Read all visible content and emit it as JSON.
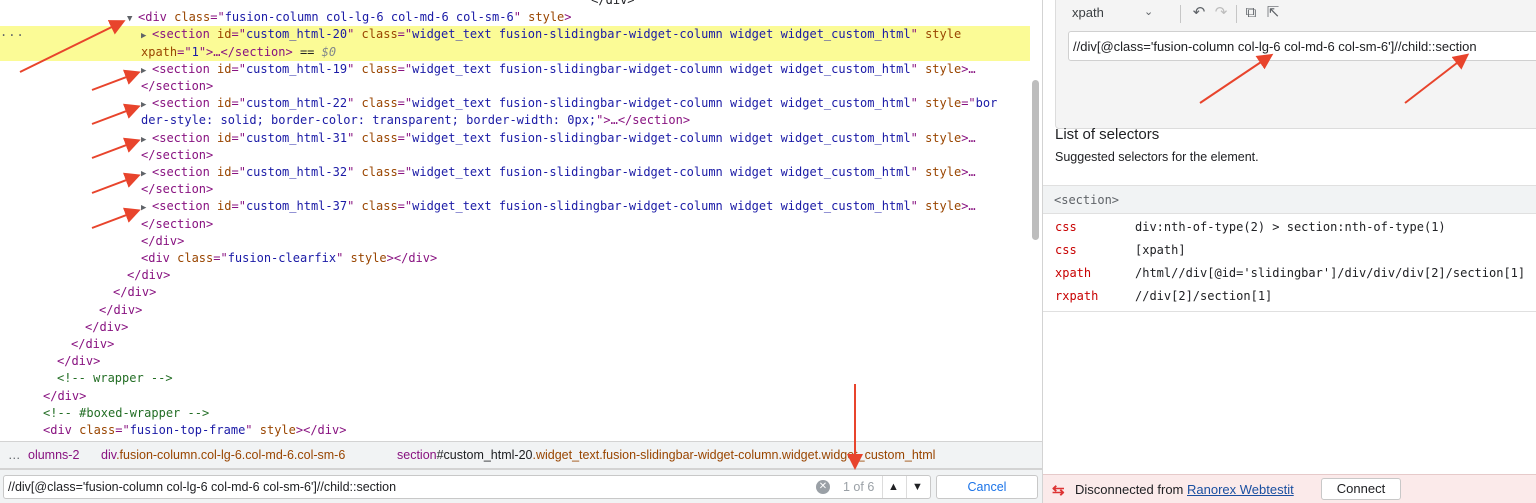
{
  "dom_tree": {
    "lines": [
      {
        "gutter": "",
        "indent": 71,
        "tokens": [
          {
            "c": "pl",
            "t": "                                                                        </div>"
          }
        ]
      },
      {
        "gutter": "",
        "indent": 127,
        "tokens": [
          {
            "c": "tri",
            "t": "▼"
          },
          {
            "c": "t",
            "t": "<div "
          },
          {
            "c": "an",
            "t": "class"
          },
          {
            "c": "t",
            "t": "=\""
          },
          {
            "c": "av",
            "t": "fusion-column col-lg-6 col-md-6 col-sm-6"
          },
          {
            "c": "t",
            "t": "\" "
          },
          {
            "c": "an",
            "t": "style"
          },
          {
            "c": "t",
            "t": ">"
          }
        ]
      },
      {
        "gutter": "...",
        "indent": 141,
        "sel": true,
        "tokens": [
          {
            "c": "tri",
            "t": "▶"
          },
          {
            "c": "t",
            "t": "<section "
          },
          {
            "c": "an",
            "t": "id"
          },
          {
            "c": "t",
            "t": "=\""
          },
          {
            "c": "av",
            "t": "custom_html-20"
          },
          {
            "c": "t",
            "t": "\" "
          },
          {
            "c": "an",
            "t": "class"
          },
          {
            "c": "t",
            "t": "=\""
          },
          {
            "c": "av",
            "t": "widget_text fusion-slidingbar-widget-column widget widget_custom_html"
          },
          {
            "c": "t",
            "t": "\" "
          },
          {
            "c": "an",
            "t": "style"
          }
        ]
      },
      {
        "gutter": "",
        "indent": 141,
        "sel": true,
        "tokens": [
          {
            "c": "an",
            "t": "xpath"
          },
          {
            "c": "t",
            "t": "=\""
          },
          {
            "c": "av",
            "t": "1"
          },
          {
            "c": "t",
            "t": "\">…</section>"
          },
          {
            "c": "pl",
            "t": " == "
          },
          {
            "c": "dim",
            "t": "$0"
          }
        ]
      },
      {
        "gutter": "",
        "indent": 141,
        "tokens": [
          {
            "c": "tri",
            "t": "▶"
          },
          {
            "c": "t",
            "t": "<section "
          },
          {
            "c": "an",
            "t": "id"
          },
          {
            "c": "t",
            "t": "=\""
          },
          {
            "c": "av",
            "t": "custom_html-19"
          },
          {
            "c": "t",
            "t": "\" "
          },
          {
            "c": "an",
            "t": "class"
          },
          {
            "c": "t",
            "t": "=\""
          },
          {
            "c": "av",
            "t": "widget_text fusion-slidingbar-widget-column widget widget_custom_html"
          },
          {
            "c": "t",
            "t": "\" "
          },
          {
            "c": "an",
            "t": "style"
          },
          {
            "c": "t",
            "t": ">…"
          }
        ]
      },
      {
        "gutter": "",
        "indent": 141,
        "tokens": [
          {
            "c": "t",
            "t": "</section>"
          }
        ]
      },
      {
        "gutter": "",
        "indent": 141,
        "tokens": [
          {
            "c": "tri",
            "t": "▶"
          },
          {
            "c": "t",
            "t": "<section "
          },
          {
            "c": "an",
            "t": "id"
          },
          {
            "c": "t",
            "t": "=\""
          },
          {
            "c": "av",
            "t": "custom_html-22"
          },
          {
            "c": "t",
            "t": "\" "
          },
          {
            "c": "an",
            "t": "class"
          },
          {
            "c": "t",
            "t": "=\""
          },
          {
            "c": "av",
            "t": "widget_text fusion-slidingbar-widget-column widget widget_custom_html"
          },
          {
            "c": "t",
            "t": "\" "
          },
          {
            "c": "an",
            "t": "style"
          },
          {
            "c": "t",
            "t": "=\""
          },
          {
            "c": "av",
            "t": "bor"
          }
        ]
      },
      {
        "gutter": "",
        "indent": 141,
        "tokens": [
          {
            "c": "av",
            "t": "der-style: solid; border-color: transparent; border-width: 0px;"
          },
          {
            "c": "t",
            "t": "\">…</section>"
          }
        ]
      },
      {
        "gutter": "",
        "indent": 141,
        "tokens": [
          {
            "c": "tri",
            "t": "▶"
          },
          {
            "c": "t",
            "t": "<section "
          },
          {
            "c": "an",
            "t": "id"
          },
          {
            "c": "t",
            "t": "=\""
          },
          {
            "c": "av",
            "t": "custom_html-31"
          },
          {
            "c": "t",
            "t": "\" "
          },
          {
            "c": "an",
            "t": "class"
          },
          {
            "c": "t",
            "t": "=\""
          },
          {
            "c": "av",
            "t": "widget_text fusion-slidingbar-widget-column widget widget_custom_html"
          },
          {
            "c": "t",
            "t": "\" "
          },
          {
            "c": "an",
            "t": "style"
          },
          {
            "c": "t",
            "t": ">…"
          }
        ]
      },
      {
        "gutter": "",
        "indent": 141,
        "tokens": [
          {
            "c": "t",
            "t": "</section>"
          }
        ]
      },
      {
        "gutter": "",
        "indent": 141,
        "tokens": [
          {
            "c": "tri",
            "t": "▶"
          },
          {
            "c": "t",
            "t": "<section "
          },
          {
            "c": "an",
            "t": "id"
          },
          {
            "c": "t",
            "t": "=\""
          },
          {
            "c": "av",
            "t": "custom_html-32"
          },
          {
            "c": "t",
            "t": "\" "
          },
          {
            "c": "an",
            "t": "class"
          },
          {
            "c": "t",
            "t": "=\""
          },
          {
            "c": "av",
            "t": "widget_text fusion-slidingbar-widget-column widget widget_custom_html"
          },
          {
            "c": "t",
            "t": "\" "
          },
          {
            "c": "an",
            "t": "style"
          },
          {
            "c": "t",
            "t": ">…"
          }
        ]
      },
      {
        "gutter": "",
        "indent": 141,
        "tokens": [
          {
            "c": "t",
            "t": "</section>"
          }
        ]
      },
      {
        "gutter": "",
        "indent": 141,
        "tokens": [
          {
            "c": "tri",
            "t": "▶"
          },
          {
            "c": "t",
            "t": "<section "
          },
          {
            "c": "an",
            "t": "id"
          },
          {
            "c": "t",
            "t": "=\""
          },
          {
            "c": "av",
            "t": "custom_html-37"
          },
          {
            "c": "t",
            "t": "\" "
          },
          {
            "c": "an",
            "t": "class"
          },
          {
            "c": "t",
            "t": "=\""
          },
          {
            "c": "av",
            "t": "widget_text fusion-slidingbar-widget-column widget widget_custom_html"
          },
          {
            "c": "t",
            "t": "\" "
          },
          {
            "c": "an",
            "t": "style"
          },
          {
            "c": "t",
            "t": ">…"
          }
        ]
      },
      {
        "gutter": "",
        "indent": 141,
        "tokens": [
          {
            "c": "t",
            "t": "</section>"
          }
        ]
      },
      {
        "gutter": "",
        "indent": 141,
        "tokens": [
          {
            "c": "t",
            "t": "</div>"
          }
        ]
      },
      {
        "gutter": "",
        "indent": 141,
        "tokens": [
          {
            "c": "t",
            "t": "<div "
          },
          {
            "c": "an",
            "t": "class"
          },
          {
            "c": "t",
            "t": "=\""
          },
          {
            "c": "av",
            "t": "fusion-clearfix"
          },
          {
            "c": "t",
            "t": "\" "
          },
          {
            "c": "an",
            "t": "style"
          },
          {
            "c": "t",
            "t": "></div>"
          }
        ]
      },
      {
        "gutter": "",
        "indent": 127,
        "tokens": [
          {
            "c": "t",
            "t": "</div>"
          }
        ]
      },
      {
        "gutter": "",
        "indent": 113,
        "tokens": [
          {
            "c": "t",
            "t": "</div>"
          }
        ]
      },
      {
        "gutter": "",
        "indent": 99,
        "tokens": [
          {
            "c": "t",
            "t": "</div>"
          }
        ]
      },
      {
        "gutter": "",
        "indent": 85,
        "tokens": [
          {
            "c": "t",
            "t": "</div>"
          }
        ]
      },
      {
        "gutter": "",
        "indent": 71,
        "tokens": [
          {
            "c": "t",
            "t": "</div>"
          }
        ]
      },
      {
        "gutter": "",
        "indent": 57,
        "tokens": [
          {
            "c": "t",
            "t": "</div>"
          }
        ]
      },
      {
        "gutter": "",
        "indent": 57,
        "tokens": [
          {
            "c": "cm",
            "t": "<!-- wrapper -->"
          }
        ]
      },
      {
        "gutter": "",
        "indent": 43,
        "tokens": [
          {
            "c": "t",
            "t": "</div>"
          }
        ]
      },
      {
        "gutter": "",
        "indent": 43,
        "tokens": [
          {
            "c": "cm",
            "t": "<!-- #boxed-wrapper -->"
          }
        ]
      },
      {
        "gutter": "",
        "indent": 43,
        "tokens": [
          {
            "c": "t",
            "t": "<div "
          },
          {
            "c": "an",
            "t": "class"
          },
          {
            "c": "t",
            "t": "=\""
          },
          {
            "c": "av",
            "t": "fusion-top-frame"
          },
          {
            "c": "t",
            "t": "\" "
          },
          {
            "c": "an",
            "t": "style"
          },
          {
            "c": "t",
            "t": "></div>"
          }
        ]
      }
    ]
  },
  "breadcrumb": {
    "more": "…",
    "item1": "olumns-2",
    "item2_tag": "div",
    "item2_cls": ".fusion-column.col-lg-6.col-md-6.col-sm-6",
    "item3_tag": "section",
    "item3_id": "#custom_html-20",
    "item3_cls": ".widget_text.fusion-slidingbar-widget-column.widget.widget_custom_html"
  },
  "search": {
    "value": "//div[@class='fusion-column col-lg-6 col-md-6 col-sm-6']//child::section",
    "count": "1 of 6",
    "clear": "✕",
    "prev": "▲",
    "next": "▼",
    "cancel": "Cancel"
  },
  "right_panel": {
    "mode": "xpath",
    "mode_caret": "⌄",
    "undo": "↶",
    "redo": "↷",
    "copy": "⧉",
    "export": "⇱",
    "query": "//div[@class='fusion-column col-lg-6 col-md-6 col-sm-6']//child::section",
    "selectors_title": "List of selectors",
    "selectors_subtitle": "Suggested selectors for the element.",
    "element_tag": "<section>",
    "selectors": [
      {
        "type": "css",
        "value": "div:nth-of-type(2) > section:nth-of-type(1)"
      },
      {
        "type": "css",
        "value": "[xpath]"
      },
      {
        "type": "xpath",
        "value": "/html//div[@id='slidingbar']/div/div/div[2]/section[1]"
      },
      {
        "type": "rxpath",
        "value": "//div[2]/section[1]"
      }
    ],
    "status_icon": "⇆",
    "status_text": "Disconnected from ",
    "status_link": "Ranorex Webtestit",
    "connect": "Connect"
  },
  "colors": {
    "arrow": "#e8442c",
    "highlight": "#fbfb96",
    "purple_button": "#6f6cd8"
  }
}
